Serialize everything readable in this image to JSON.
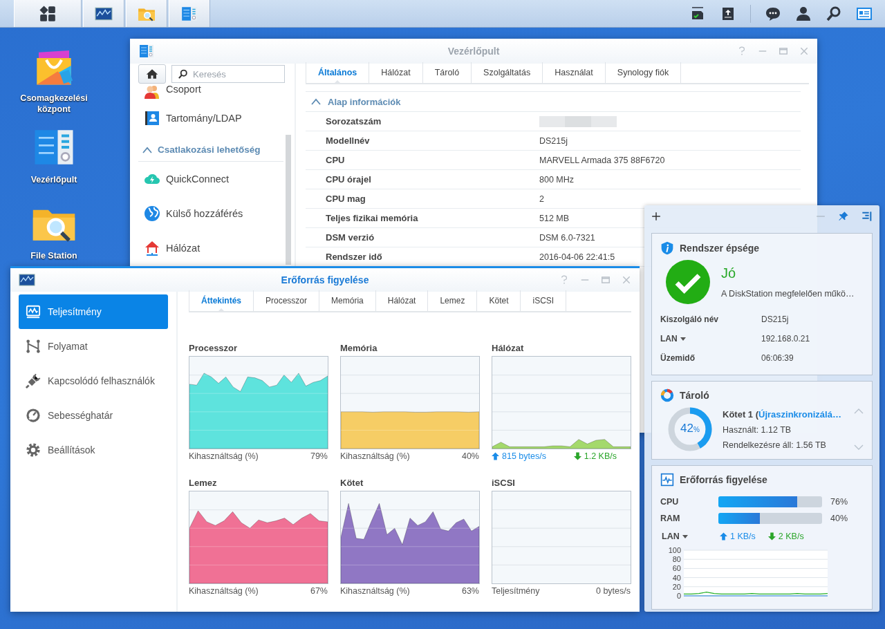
{
  "taskbar": {
    "apps": [
      {
        "kind": "main-menu"
      },
      {
        "kind": "resource-monitor"
      },
      {
        "kind": "file-station"
      },
      {
        "kind": "control-panel"
      }
    ],
    "tray": [
      {
        "kind": "notification"
      },
      {
        "kind": "upload"
      },
      {
        "kind": "chat"
      },
      {
        "kind": "user"
      },
      {
        "kind": "search"
      },
      {
        "kind": "widgets"
      }
    ]
  },
  "desktop_icons": [
    {
      "label": "Csomagkezelési központ",
      "kind": "package"
    },
    {
      "label": "Vezérlőpult",
      "kind": "control-panel"
    },
    {
      "label": "File Station",
      "kind": "file-station"
    }
  ],
  "control_panel": {
    "title": "Vezérlőpult",
    "search": {
      "placeholder": "Keresés"
    },
    "sidebar": [
      {
        "kind": "item",
        "label": "Csoport"
      },
      {
        "kind": "item",
        "label": "Tartomány/LDAP"
      },
      {
        "kind": "section",
        "label": "Csatlakozási lehetőség",
        "expanded": true
      },
      {
        "kind": "item",
        "label": "QuickConnect"
      },
      {
        "kind": "item",
        "label": "Külső hozzáférés"
      },
      {
        "kind": "item",
        "label": "Hálózat"
      }
    ],
    "tabs": [
      {
        "label": "Általános",
        "selected": true
      },
      {
        "label": "Hálózat",
        "selected": false
      },
      {
        "label": "Tároló",
        "selected": false
      },
      {
        "label": "Szolgáltatás",
        "selected": false
      },
      {
        "label": "Használat",
        "selected": false
      },
      {
        "label": "Synology fiók",
        "selected": false
      }
    ],
    "section": {
      "title": "Alap információk",
      "expanded": true
    },
    "rows": [
      {
        "label": "Sorozatszám",
        "redacted": true
      },
      {
        "label": "Modellnév",
        "value": "DS215j"
      },
      {
        "label": "CPU",
        "value": "MARVELL Armada 375 88F6720"
      },
      {
        "label": "CPU órajel",
        "value": "800 MHz"
      },
      {
        "label": "CPU mag",
        "value": "2"
      },
      {
        "label": "Teljes fizikai memória",
        "value": "512 MB"
      },
      {
        "label": "DSM verzió",
        "value": "DSM 6.0-7321"
      },
      {
        "label": "Rendszer idő",
        "value": "2016-04-06 22:41:5"
      }
    ]
  },
  "resource_monitor": {
    "title": "Erőforrás figyelése",
    "sidebar": [
      {
        "label": "Teljesítmény",
        "selected": true
      },
      {
        "label": "Folyamat",
        "selected": false
      },
      {
        "label": "Kapcsolódó felhasználók",
        "selected": false
      },
      {
        "label": "Sebességhatár",
        "selected": false
      },
      {
        "label": "Beállítások",
        "selected": false
      }
    ],
    "tabs": [
      {
        "label": "Áttekintés",
        "selected": true
      },
      {
        "label": "Processzor",
        "selected": false
      },
      {
        "label": "Memória",
        "selected": false
      },
      {
        "label": "Hálózat",
        "selected": false
      },
      {
        "label": "Lemez",
        "selected": false
      },
      {
        "label": "Kötet",
        "selected": false
      },
      {
        "label": "iSCSI",
        "selected": false
      }
    ],
    "panels": [
      {
        "kind": "usage",
        "title": "Processzor",
        "caption": "Kihasználtság (%)",
        "value": "79%",
        "color": "#5ee3dd"
      },
      {
        "kind": "usage",
        "title": "Memória",
        "caption": "Kihasználtság (%)",
        "value": "40%",
        "color": "#f6cd65"
      },
      {
        "kind": "network",
        "title": "Hálózat",
        "up": "815 bytes/s",
        "down": "1.2 KB/s",
        "color": "#a4d96c"
      },
      {
        "kind": "usage",
        "title": "Lemez",
        "caption": "Kihasználtság (%)",
        "value": "67%",
        "color": "#f07195"
      },
      {
        "kind": "usage",
        "title": "Kötet",
        "caption": "Kihasználtság (%)",
        "value": "63%",
        "color": "#9077c4"
      },
      {
        "kind": "usage",
        "title": "iSCSI",
        "caption": "Teljesítmény",
        "value": "0 bytes/s"
      }
    ]
  },
  "widgets": {
    "health": {
      "title": "Rendszer épsége",
      "status": "Jó",
      "message": "A DiskStation megfelelően műkö…",
      "rows": [
        {
          "label": "Kiszolgáló név",
          "value": "DS215j",
          "dropdown": false
        },
        {
          "label": "LAN",
          "value": "192.168.0.21",
          "dropdown": true
        },
        {
          "label": "Üzemidő",
          "value": "06:06:39",
          "dropdown": false
        }
      ]
    },
    "storage": {
      "title": "Tároló",
      "volume": "Kötet 1 (",
      "status": "Újraszinkronizálá…",
      "used": "Használt: 1.12 TB",
      "available": "Rendelkezésre áll: 1.56 TB",
      "percent": "42",
      "unit": "%",
      "level": 0.42
    },
    "monitor": {
      "title": "Erőforrás figyelése",
      "bars": [
        {
          "label": "CPU",
          "level": 0.76,
          "reading": "76%"
        },
        {
          "label": "RAM",
          "level": 0.4,
          "reading": "40%"
        }
      ],
      "lan": {
        "label": "LAN",
        "up": "1 KB/s",
        "down": "2 KB/s"
      },
      "chart_data": {
        "type": "line",
        "ylim": [
          0,
          100
        ],
        "yticks": [
          0,
          20,
          40,
          60,
          80,
          100
        ],
        "grid": true,
        "series": [
          {
            "color": "#27b027",
            "values": [
              4,
              4,
              5,
              8,
              5,
              4,
              4,
              4,
              4,
              5,
              4,
              4,
              4,
              4,
              4,
              5,
              4,
              4,
              4,
              5
            ]
          },
          {
            "color": "#1a7fd4",
            "values": [
              0,
              0,
              0,
              0,
              0,
              0,
              0,
              0,
              0,
              0,
              0,
              0,
              0,
              0,
              0,
              0,
              0,
              0,
              0,
              0
            ]
          }
        ]
      }
    }
  }
}
